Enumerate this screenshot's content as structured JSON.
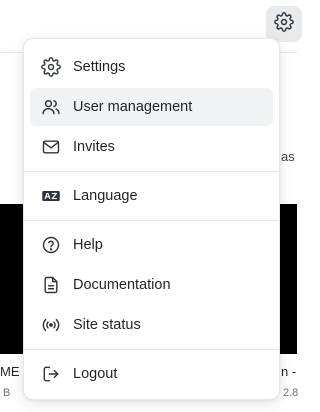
{
  "background": {
    "right_text_1": "as",
    "bottom_left_1": "ME",
    "bottom_left_2": "B",
    "bottom_right_1": "n -",
    "bottom_right_2": "2.8"
  },
  "menu": {
    "items": [
      {
        "label": "Settings",
        "icon": "gear-icon"
      },
      {
        "label": "User management",
        "icon": "users-icon"
      },
      {
        "label": "Invites",
        "icon": "mail-icon"
      },
      {
        "label": "Language",
        "icon": "language-icon"
      },
      {
        "label": "Help",
        "icon": "help-circle-icon"
      },
      {
        "label": "Documentation",
        "icon": "document-icon"
      },
      {
        "label": "Site status",
        "icon": "broadcast-icon"
      },
      {
        "label": "Logout",
        "icon": "logout-icon"
      }
    ]
  }
}
